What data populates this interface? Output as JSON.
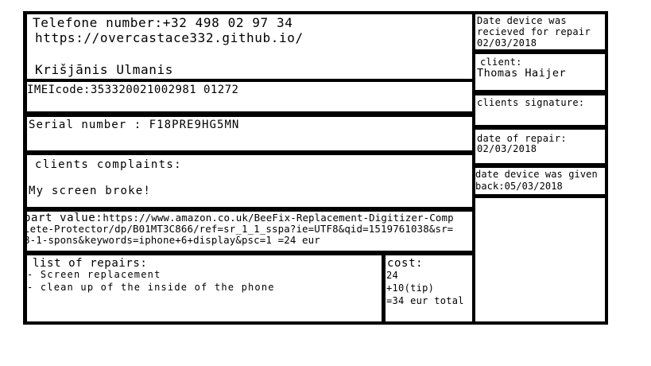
{
  "contact": {
    "phone": "Telefone number:+32 498 02 97 34",
    "website": "https://overcastace332.github.io/",
    "name": "Krišjānis Ulmanis"
  },
  "imei": "IMEIcode:353320021002981 01272",
  "serial": "Serial number : F18PRE9HG5MN",
  "complaints": {
    "label": "clients complaints:",
    "text": "My screen broke!"
  },
  "part_value": {
    "label": "part value:",
    "text": "https://www.amazon.co.uk/BeeFix-Replacement-Digitizer-Complete-Protector/dp/B01MT3C866/ref=sr_1_1_sspa?ie=UTF8&qid=1519761038&sr=8-1-spons&keywords=iphone+6+display&psc=1 =24 eur"
  },
  "repairs": {
    "label": "list of repairs:",
    "items": [
      "- Screen replacement",
      "- clean up of the inside of the phone"
    ]
  },
  "cost": {
    "label": "cost:",
    "lines": [
      "24",
      "+10(tip)",
      "=34 eur total"
    ]
  },
  "received": {
    "label_line1": "Date device was",
    "label_line2": "recieved for repair",
    "date": "02/03/2018"
  },
  "client": {
    "label": "client:",
    "name": "Thomas Haijer"
  },
  "signature": {
    "label": "clients signature:"
  },
  "repair_date": {
    "label": "date of repair:",
    "date": "02/03/2018"
  },
  "given_back": {
    "label": "date device was given",
    "value": "back:05/03/2018"
  }
}
